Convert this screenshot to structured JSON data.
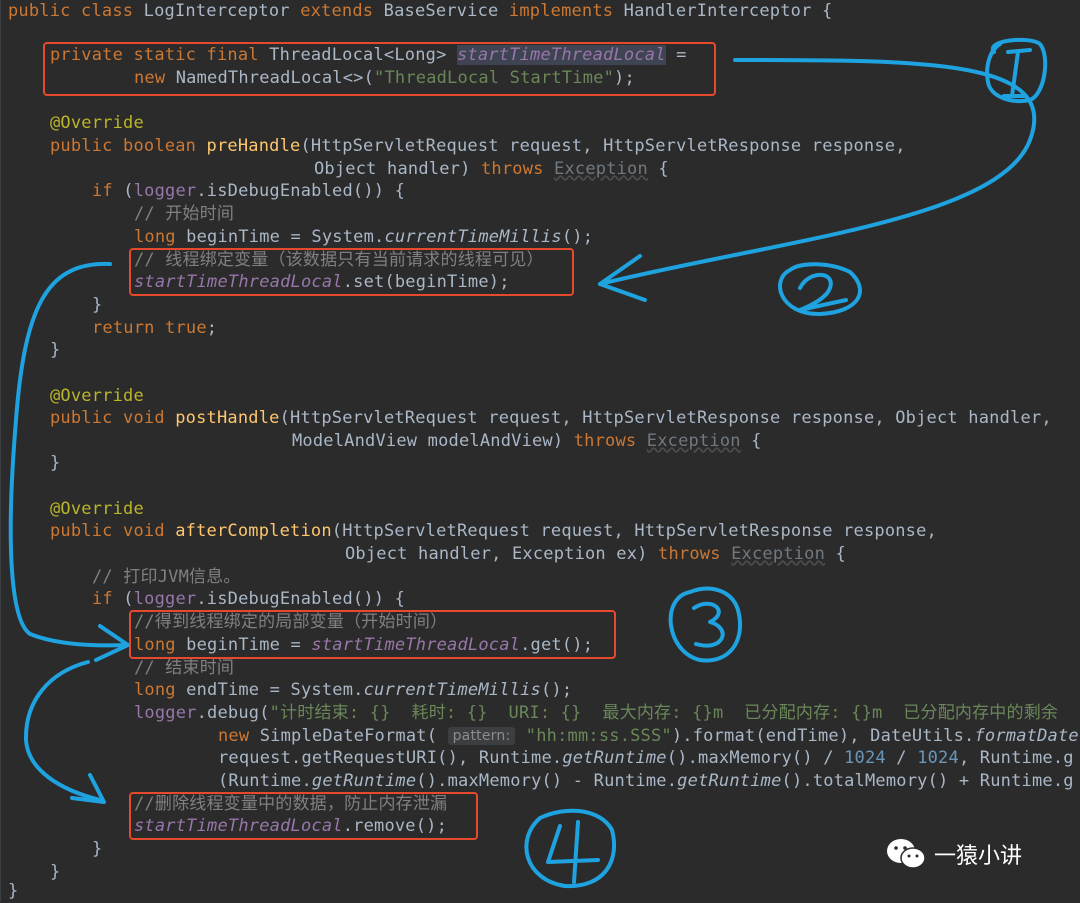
{
  "colors": {
    "background": "#2b2b2b",
    "keyword": "#cc7832",
    "annotation": "#bbb529",
    "string": "#6a8759",
    "number": "#6897bb",
    "comment": "#808080",
    "field": "#9876aa",
    "method": "#ffc66d",
    "plain": "#a9b7c6",
    "highlight_box": "#e64a2e",
    "handdrawn_annotation": "#1fa3e0"
  },
  "code": {
    "l1": {
      "k1": "public class",
      "name": " LogInterceptor ",
      "k2": "extends",
      "base": " BaseService ",
      "k3": "implements",
      "iface": " HandlerInterceptor {"
    },
    "l2": {
      "k": "private static final",
      "t": " ThreadLocal<Long> ",
      "f": "startTimeThreadLocal",
      "eq": " ="
    },
    "l3": {
      "k": "new",
      "t": " NamedThreadLocal<>(",
      "s": "\"ThreadLocal StartTime\"",
      "end": ");"
    },
    "annotation": "@Override",
    "l5": {
      "k": "public boolean",
      "fn": " preHandle",
      "p": "(HttpServletRequest request, HttpServletResponse response,"
    },
    "l6": {
      "p": "Object handler) ",
      "k": "throws",
      "sp": " ",
      "exc": "Exception",
      "end": " {"
    },
    "l7": {
      "k": "if",
      "p": " (",
      "f": "logger",
      "end": ".isDebugEnabled()) {"
    },
    "l8": "// 开始时间",
    "l9": {
      "k": "long",
      "p": " beginTime = System.",
      "m": "currentTimeMillis",
      "end": "();"
    },
    "l10": "// 线程绑定变量（该数据只有当前请求的线程可见）",
    "l11": {
      "f": "startTimeThreadLocal",
      "end": ".set(beginTime);"
    },
    "brace": "}",
    "l13": {
      "k": "return",
      "v": " true",
      "end": ";"
    },
    "l17": {
      "k": "public void",
      "fn": " postHandle",
      "p": "(HttpServletRequest request, HttpServletResponse response, Object handler,"
    },
    "l18": {
      "p": "ModelAndView modelAndView) ",
      "k": "throws",
      "sp": " ",
      "exc": "Exception",
      "end": " {"
    },
    "l22": {
      "k": "public void",
      "fn": " afterCompletion",
      "p": "(HttpServletRequest request, HttpServletResponse response,"
    },
    "l23": {
      "p": "Object handler, Exception ex) ",
      "k": "throws",
      "sp": " ",
      "exc": "Exception",
      "end": " {"
    },
    "l24": "// 打印JVM信息。",
    "l26": "//得到线程绑定的局部变量（开始时间）",
    "l27": {
      "k": "long",
      "p": " beginTime = ",
      "f": "startTimeThreadLocal",
      "end": ".get();"
    },
    "l28": "// 结束时间",
    "l29": {
      "k": "long",
      "p": " endTime = System.",
      "m": "currentTimeMillis",
      "end": "();"
    },
    "l30": {
      "f": "logger",
      "p": ".debug(",
      "s": "\"计时结束: {}  耗时: {}  URI: {}  最大内存: {}m  已分配内存: {}m  已分配内存中的剩余"
    },
    "l31": {
      "k": "new",
      "p": " SimpleDateFormat( ",
      "hint": "pattern:",
      "s": " \"hh:mm:ss.SSS\"",
      "p2": ").format(endTime), DateUtils.",
      "m": "formatDate"
    },
    "l32": {
      "p": "request.getRequestURI(), Runtime.",
      "m": "getRuntime",
      "p2": "().maxMemory() / ",
      "n1": "1024",
      "p3": " / ",
      "n2": "1024",
      "p4": ", Runtime.g"
    },
    "l33": {
      "p": "(Runtime.",
      "m": "getRuntime",
      "p2": "().maxMemory() - Runtime.",
      "m2": "getRuntime",
      "p3": "().totalMemory() + Runtime.g"
    },
    "l34": "//删除线程变量中的数据，防止内存泄漏",
    "l35": {
      "f": "startTimeThreadLocal",
      "end": ".remove();"
    }
  },
  "watermark": {
    "icon": "wechat-icon",
    "text": "一猿小讲"
  }
}
